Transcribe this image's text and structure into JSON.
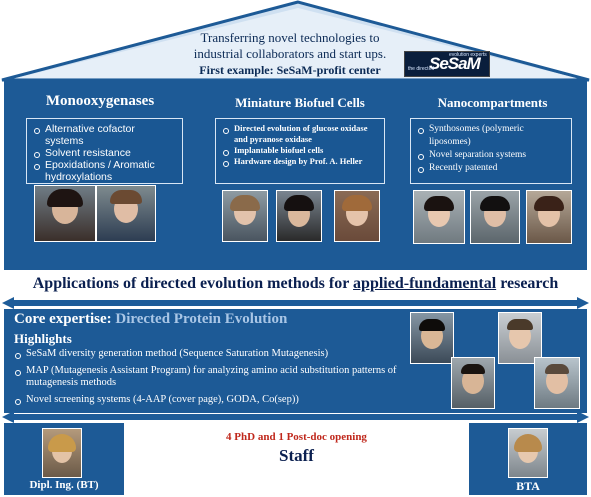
{
  "roof": {
    "line1": "Transferring novel technologies to",
    "line2": "industrial collaborators and start ups.",
    "line3": "First example: SeSaM-profit center",
    "logo_main": "SeSaM",
    "logo_top": "evolution experts",
    "logo_sub": "the directed"
  },
  "columns": [
    {
      "title": "Monooxygenases",
      "items": [
        "Alternative cofactor systems",
        "Solvent resistance",
        "Epoxidations / Aromatic hydroxylations"
      ]
    },
    {
      "title": "Miniature Biofuel Cells",
      "items": [
        "Directed evolution of glucose oxidase and pyranose oxidase",
        "Implantable biofuel cells",
        "Hardware design by Prof. A. Heller"
      ]
    },
    {
      "title": "Nanocompartments",
      "items": [
        "Synthosomes (polymeric liposomes)",
        "Novel separation systems",
        "Recently patented"
      ]
    }
  ],
  "applications": {
    "before": "Applications of directed evolution methods for ",
    "underlined": "applied-fundamental",
    "after": " research"
  },
  "core": {
    "title_label": "Core expertise:",
    "title_value": "Directed Protein Evolution",
    "highlights_label": "Highlights",
    "items": [
      "SeSaM diversity generation method (Sequence Saturation Mutagenesis)",
      "MAP (Mutagenesis Assistant Program) for analyzing amino acid substitution patterns of mutagenesis methods",
      "Novel screening systems (4-AAP (cover page), GODA, Co(sep))"
    ]
  },
  "staff": {
    "opening": "4 PhD and  1 Post-doc opening",
    "label": "Staff",
    "left_caption": "Dipl. Ing. (BT)",
    "right_caption": "BTA"
  },
  "colors": {
    "dark_blue": "#1d5a96",
    "roof_blue": "#2266a8",
    "text_navy": "#0b2050",
    "opening_red": "#c0281c"
  }
}
